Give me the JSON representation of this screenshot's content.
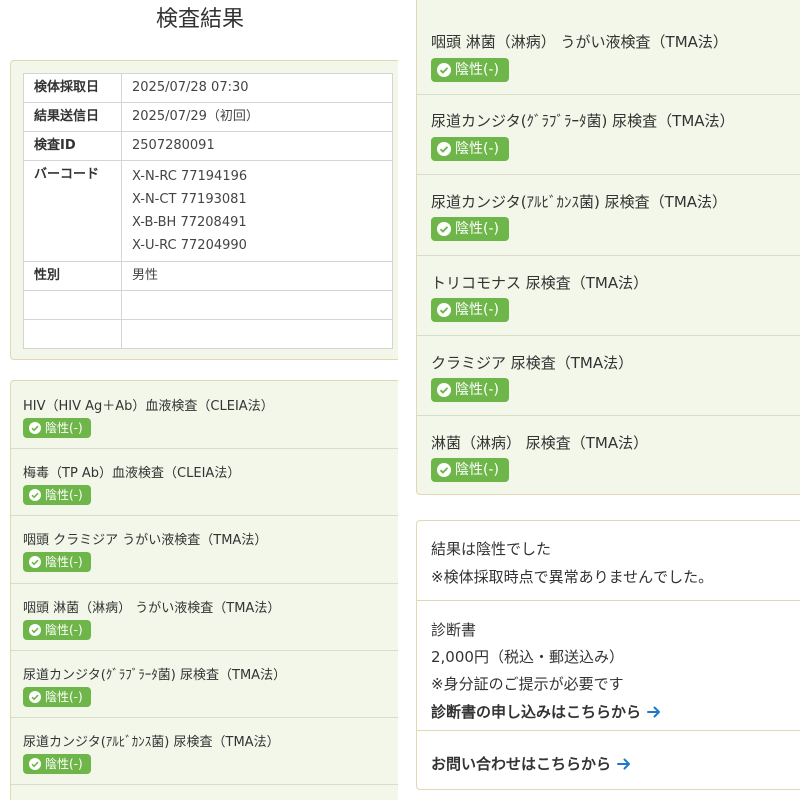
{
  "page": {
    "title": "検査結果"
  },
  "info": {
    "rows": [
      {
        "label": "検体採取日",
        "value": "2025/07/28 07:30"
      },
      {
        "label": "結果送信日",
        "value": "2025/07/29（初回）"
      },
      {
        "label": "検査ID",
        "value": "2507280091"
      }
    ],
    "barcode": {
      "label": "バーコード",
      "values": [
        "X-N-RC 77194196",
        "X-N-CT 77193081",
        "X-B-BH 77208491",
        "X-U-RC 77204990"
      ]
    },
    "sex": {
      "label": "性別",
      "value": "男性"
    }
  },
  "results_left": [
    {
      "name": "HIV（HIV Ag＋Ab）血液検査（CLEIA法）",
      "result": "陰性(-)"
    },
    {
      "name": "梅毒（TP Ab）血液検査（CLEIA法）",
      "result": "陰性(-)"
    },
    {
      "name": "咽頭 クラミジア うがい液検査（TMA法）",
      "result": "陰性(-)"
    },
    {
      "name": "咽頭 淋菌（淋病） うがい液検査（TMA法）",
      "result": "陰性(-)"
    },
    {
      "name": "尿道カンジタ(ｸﾞﾗﾌﾞﾗｰﾀ菌) 尿検査（TMA法）",
      "result": "陰性(-)"
    },
    {
      "name": "尿道カンジタ(ｱﾙﾋﾞｶﾝｽ菌) 尿検査（TMA法）",
      "result": "陰性(-)"
    }
  ],
  "results_right": [
    {
      "name": "咽頭 淋菌（淋病） うがい液検査（TMA法）",
      "result": "陰性(-)"
    },
    {
      "name": "尿道カンジタ(ｸﾞﾗﾌﾞﾗｰﾀ菌) 尿検査（TMA法）",
      "result": "陰性(-)"
    },
    {
      "name": "尿道カンジタ(ｱﾙﾋﾞｶﾝｽ菌) 尿検査（TMA法）",
      "result": "陰性(-)"
    },
    {
      "name": "トリコモナス 尿検査（TMA法）",
      "result": "陰性(-)"
    },
    {
      "name": "クラミジア 尿検査（TMA法）",
      "result": "陰性(-)"
    },
    {
      "name": "淋菌（淋病） 尿検査（TMA法）",
      "result": "陰性(-)"
    }
  ],
  "summary": {
    "line1": "結果は陰性でした",
    "line2": "※検体採取時点で異常ありませんでした。"
  },
  "diagnosis": {
    "title": "診断書",
    "price": "2,000円（税込・郵送込み）",
    "note": "※身分証のご提示が必要です",
    "link": "診断書の申し込みはこちらから"
  },
  "contact": {
    "link": "お問い合わせはこちらから"
  },
  "colors": {
    "badge": "#6fb64a",
    "card_bg": "#f2f7ea",
    "card_border": "#e3d8b5",
    "link": "#1e78c8"
  },
  "icons": {
    "badge": "check-circle-icon",
    "link": "arrow-right-icon"
  }
}
